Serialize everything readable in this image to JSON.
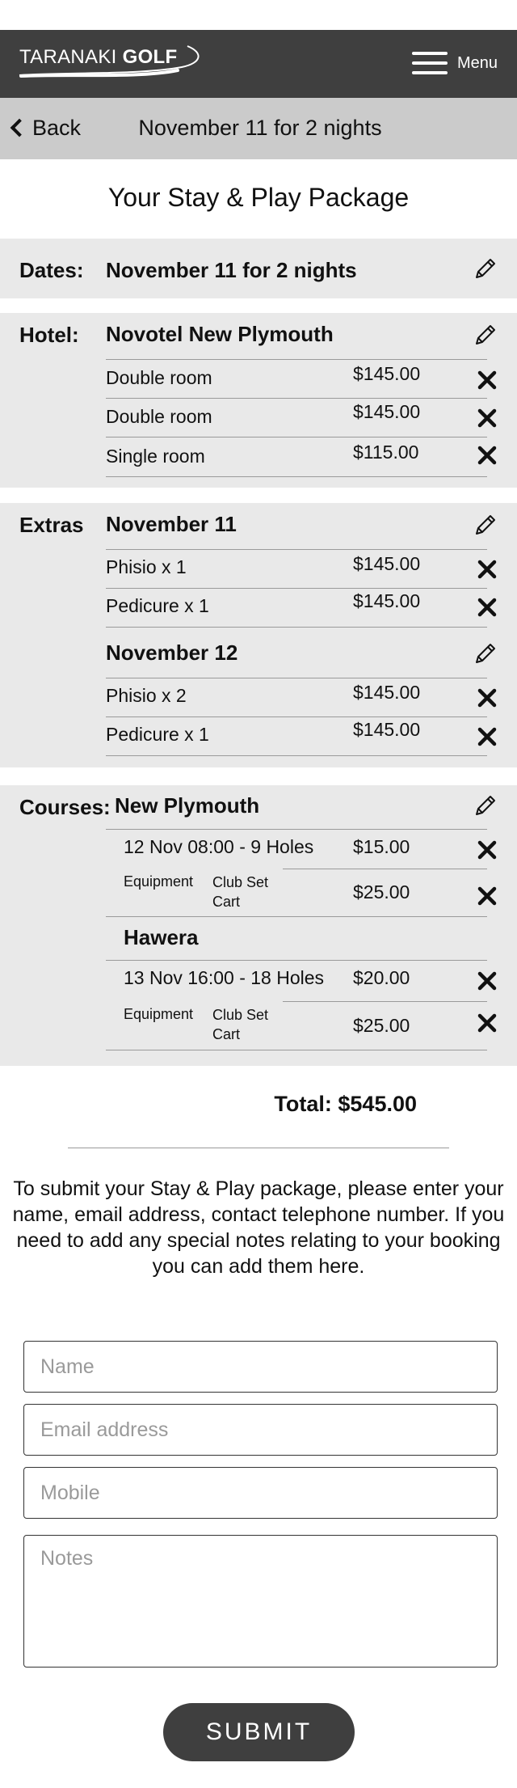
{
  "header": {
    "logo_light": "TARANAKI",
    "logo_bold": "GOLF",
    "menu_label": "Menu"
  },
  "subbar": {
    "back_label": "Back",
    "title": "November 11 for 2 nights"
  },
  "page_title": "Your Stay & Play Package",
  "dates": {
    "label": "Dates:",
    "value": "November 11 for 2 nights"
  },
  "hotel": {
    "label": "Hotel:",
    "name": "Novotel New Plymouth",
    "rooms": [
      {
        "name": "Double room",
        "price": "$145.00"
      },
      {
        "name": "Double room",
        "price": "$145.00"
      },
      {
        "name": "Single room",
        "price": "$115.00"
      }
    ]
  },
  "extras": {
    "label": "Extras",
    "days": [
      {
        "date": "November 11",
        "items": [
          {
            "name": "Phisio x 1",
            "price": "$145.00"
          },
          {
            "name": "Pedicure x 1",
            "price": "$145.00"
          }
        ]
      },
      {
        "date": "November 12",
        "items": [
          {
            "name": "Phisio x 2",
            "price": "$145.00"
          },
          {
            "name": "Pedicure x 1",
            "price": "$145.00"
          }
        ]
      }
    ]
  },
  "courses": {
    "label": "Courses:",
    "list": [
      {
        "name": "New Plymouth",
        "tee": "12 Nov 08:00  - 9 Holes",
        "tee_price": "$15.00",
        "equipment_label": "Equipment",
        "equipment_items": [
          "Club Set",
          "Cart"
        ],
        "equipment_price": "$25.00"
      },
      {
        "name": "Hawera",
        "tee": "13 Nov 16:00  - 18 Holes",
        "tee_price": "$20.00",
        "equipment_label": "Equipment",
        "equipment_items": [
          "Club Set",
          "Cart"
        ],
        "equipment_price": "$25.00"
      }
    ]
  },
  "total": "Total: $545.00",
  "intro": "To submit your Stay & Play package, please enter your name, email address, contact telephone number. If you need to add any special notes relating to your booking you can add them here.",
  "form": {
    "name_placeholder": "Name",
    "email_placeholder": "Email address",
    "mobile_placeholder": "Mobile",
    "notes_placeholder": "Notes",
    "submit_label": "SUBMIT"
  },
  "icons": {
    "edit": "pencil-icon",
    "remove": "close-icon",
    "back": "chevron-left-icon",
    "menu": "hamburger-icon"
  },
  "colors": {
    "header_bg": "#3f3f3f",
    "subbar_bg": "#cbcbcb",
    "panel_bg": "#e9e9e9",
    "button_bg": "#3f3f3f"
  }
}
